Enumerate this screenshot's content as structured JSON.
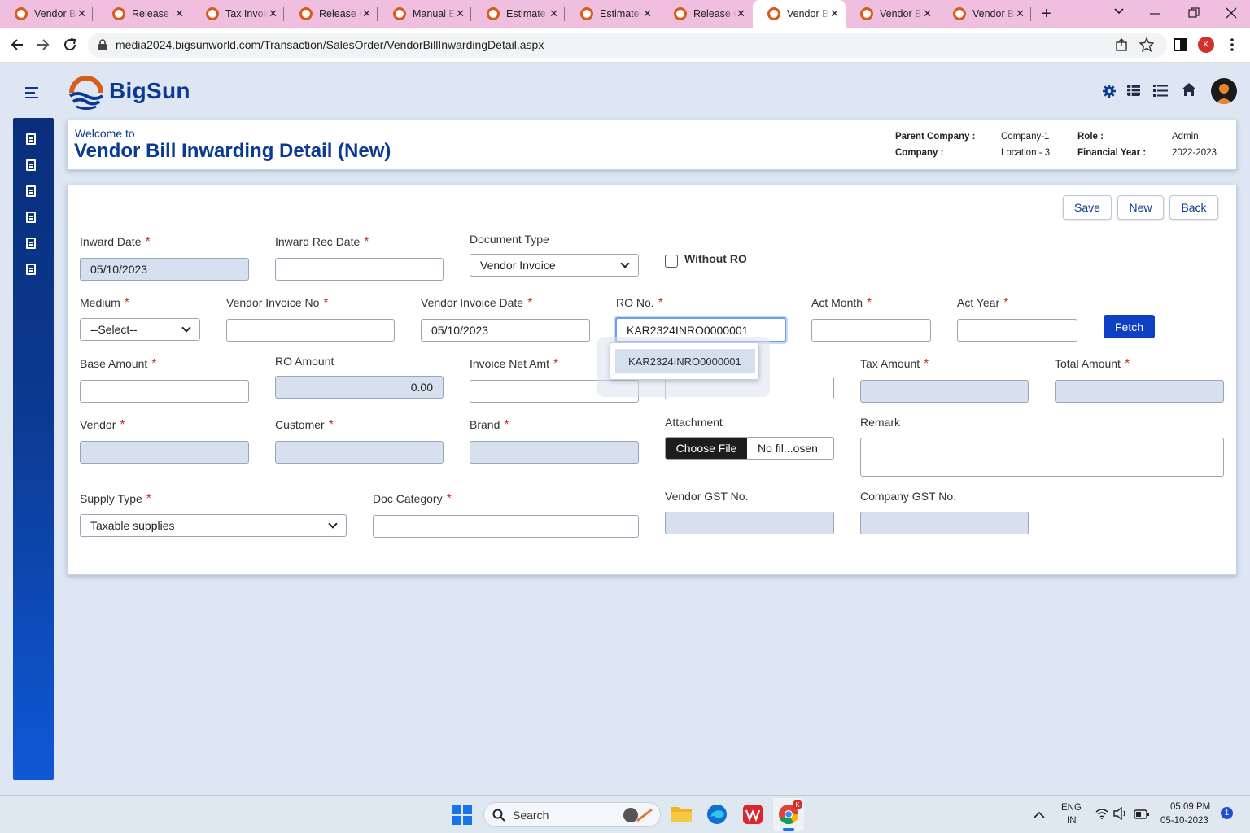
{
  "browser": {
    "tabs": [
      {
        "label": "Vendor Bill",
        "active": false
      },
      {
        "label": "Release Order",
        "active": false
      },
      {
        "label": "Tax Invoice",
        "active": false
      },
      {
        "label": "Release Order",
        "active": false
      },
      {
        "label": "Manual Entry",
        "active": false
      },
      {
        "label": "Estimate",
        "active": false
      },
      {
        "label": "Estimate",
        "active": false
      },
      {
        "label": "Release Order",
        "active": false
      },
      {
        "label": "Vendor Bill",
        "active": true
      },
      {
        "label": "Vendor Bill",
        "active": false
      },
      {
        "label": "Vendor Bill",
        "active": false
      }
    ],
    "new_tab": "+",
    "url": "media2024.bigsunworld.com/Transaction/SalesOrder/VendorBillInwardingDetail.aspx",
    "profile_initial": "K",
    "tab_close": "✕"
  },
  "app": {
    "logo_text": "BigSun",
    "header": {
      "welcome": "Welcome to",
      "title": "Vendor Bill Inwarding Detail (New)",
      "parent_company_label": "Parent Company :",
      "parent_company_value": "Company-1",
      "company_label": "Company :",
      "company_value": "Location - 3",
      "role_label": "Role :",
      "role_value": "Admin",
      "fy_label": "Financial Year :",
      "fy_value": "2022-2023"
    },
    "buttons": {
      "save": "Save",
      "new": "New",
      "back": "Back",
      "fetch": "Fetch"
    },
    "form": {
      "inward_date": {
        "label": "Inward Date",
        "value": "05/10/2023"
      },
      "inward_rec_date": {
        "label": "Inward Rec Date",
        "value": ""
      },
      "document_type": {
        "label": "Document Type",
        "value": "Vendor Invoice"
      },
      "without_ro": {
        "label": "Without RO",
        "checked": false
      },
      "medium": {
        "label": "Medium",
        "value": "--Select--"
      },
      "vendor_invoice_no": {
        "label": "Vendor Invoice No",
        "value": ""
      },
      "vendor_invoice_date": {
        "label": "Vendor Invoice Date",
        "value": "05/10/2023"
      },
      "ro_no": {
        "label": "RO No.",
        "value": "KAR2324INRO0000001"
      },
      "ro_suggestion": "KAR2324INRO0000001",
      "act_month": {
        "label": "Act Month",
        "value": ""
      },
      "act_year": {
        "label": "Act Year",
        "value": ""
      },
      "base_amount": {
        "label": "Base Amount",
        "value": ""
      },
      "ro_amount": {
        "label": "RO Amount",
        "value": "0.00"
      },
      "invoice_net_amt": {
        "label": "Invoice Net Amt",
        "value": ""
      },
      "tax_amount": {
        "label": "Tax Amount",
        "value": ""
      },
      "total_amount": {
        "label": "Total Amount",
        "value": ""
      },
      "vendor": {
        "label": "Vendor",
        "value": ""
      },
      "customer": {
        "label": "Customer",
        "value": ""
      },
      "brand": {
        "label": "Brand",
        "value": ""
      },
      "attachment": {
        "label": "Attachment",
        "button": "Choose File",
        "status": "No fil...osen"
      },
      "remark": {
        "label": "Remark",
        "value": ""
      },
      "supply_type": {
        "label": "Supply Type",
        "value": "Taxable supplies"
      },
      "doc_category": {
        "label": "Doc Category",
        "value": ""
      },
      "vendor_gst": {
        "label": "Vendor GST No.",
        "value": ""
      },
      "company_gst": {
        "label": "Company GST No.",
        "value": ""
      },
      "required_mark": "*"
    }
  },
  "taskbar": {
    "search": "Search",
    "lang1": "ENG",
    "lang2": "IN",
    "time": "05:09 PM",
    "date": "05-10-2023",
    "notif_count": "1"
  },
  "colors": {
    "brand": "#0b3a92",
    "tabstrip": "#f0bfdf",
    "logo_orange": "#d95b18"
  }
}
